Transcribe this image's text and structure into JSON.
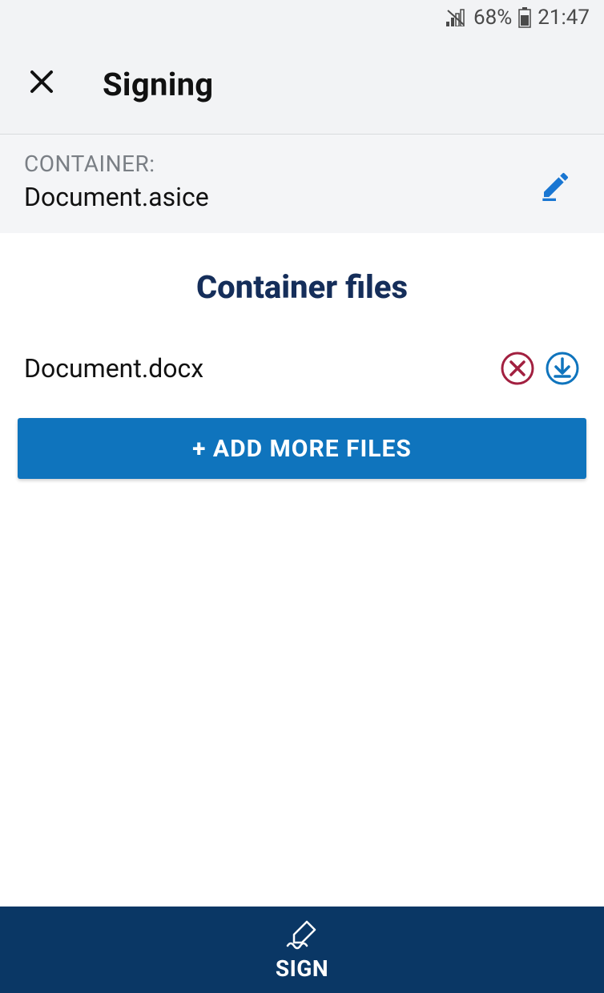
{
  "status_bar": {
    "battery": "68%",
    "time": "21:47"
  },
  "app_bar": {
    "title": "Signing"
  },
  "container": {
    "label": "CONTAINER:",
    "name": "Document.asice"
  },
  "files_section": {
    "title": "Container files",
    "items": [
      {
        "name": "Document.docx"
      }
    ],
    "add_button": "+ ADD MORE FILES"
  },
  "sign_bar": {
    "label": "SIGN"
  }
}
